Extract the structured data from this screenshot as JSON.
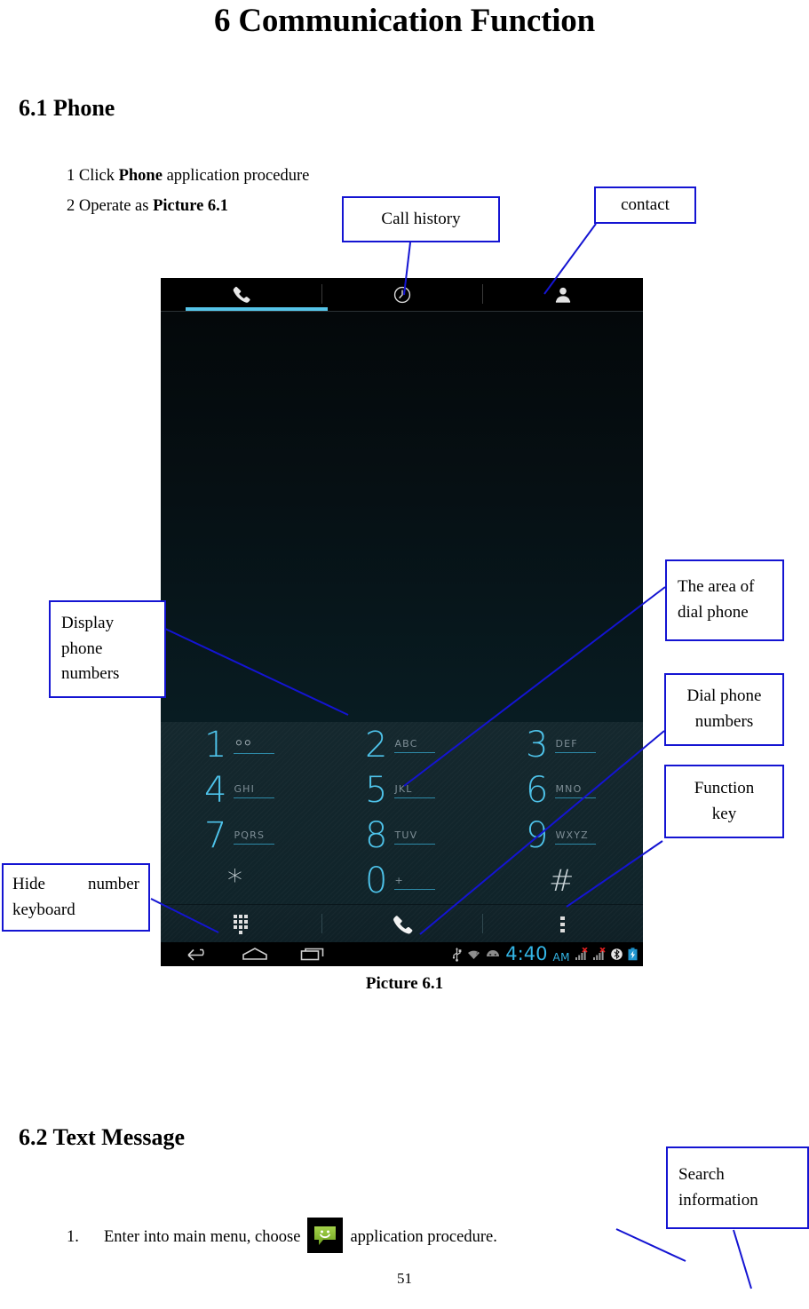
{
  "document": {
    "title": "6 Communication Function",
    "section_61": "6.1 Phone",
    "section_62": "6.2 Text Message",
    "step_1_pre": "1 Click ",
    "step_1_bold": "Phone",
    "step_1_post": " application procedure",
    "step_2_pre": "2 Operate as ",
    "step_2_bold": "Picture 6.1",
    "figure_caption": "Picture 6.1",
    "page_number": "51",
    "msg_item_number": "1.",
    "msg_item_text_a": "Enter into main menu, choose",
    "msg_item_text_b": "application procedure.",
    "sms_icon": "message-bubble-icon"
  },
  "callouts": {
    "call_history": {
      "label": "Call history"
    },
    "contact": {
      "label": "contact"
    },
    "display_phone_numbers": {
      "line1": "Display",
      "line2": "phone",
      "line3": "numbers"
    },
    "hide_number_keyboard": {
      "line1": "Hide",
      "line2": "number",
      "line3": "keyboard"
    },
    "area_of_dial_phone": {
      "line1": "The area of",
      "line2": "dial phone"
    },
    "dial_phone_numbers": {
      "line1": "Dial phone",
      "line2": "numbers"
    },
    "function_key": {
      "line1": "Function",
      "line2": "key"
    },
    "search_information": {
      "line1": "Search",
      "line2": "information"
    }
  },
  "phone": {
    "tabs": [
      {
        "name": "dialer-tab",
        "icon": "phone-handset-icon",
        "selected": true
      },
      {
        "name": "call-log-tab",
        "icon": "clock-icon",
        "selected": false
      },
      {
        "name": "contacts-tab",
        "icon": "person-icon",
        "selected": false
      }
    ],
    "accent_color": "#56c4e8",
    "digit_color": "#4ec3ea",
    "keypad": [
      {
        "digit": "1",
        "sub": "voicemail-glyph",
        "is_voicemail": true
      },
      {
        "digit": "2",
        "sub": "ABC"
      },
      {
        "digit": "3",
        "sub": "DEF"
      },
      {
        "digit": "4",
        "sub": "GHI"
      },
      {
        "digit": "5",
        "sub": "JKL"
      },
      {
        "digit": "6",
        "sub": "MNO"
      },
      {
        "digit": "7",
        "sub": "PQRS"
      },
      {
        "digit": "8",
        "sub": "TUV"
      },
      {
        "digit": "9",
        "sub": "WXYZ"
      },
      {
        "digit": "*",
        "sub": ""
      },
      {
        "digit": "0",
        "sub": "+"
      },
      {
        "digit": "#",
        "sub": ""
      }
    ],
    "actions": [
      {
        "name": "hide-dialpad-button",
        "icon": "dialpad-grid-icon"
      },
      {
        "name": "dial-call-button",
        "icon": "phone-handset-icon"
      },
      {
        "name": "overflow-menu-button",
        "icon": "three-dots-vertical-icon"
      }
    ],
    "navbar": {
      "back": "back-arrow-icon",
      "home": "home-icon",
      "recents": "recents-icon",
      "status_icons": [
        "usb-icon",
        "wifi-unknown-icon",
        "android-head-icon",
        "signal-no-sim-1-icon",
        "signal-no-sim-2-icon",
        "bluetooth-icon",
        "battery-charging-icon"
      ],
      "time": "4:40",
      "ampm": "AM"
    }
  }
}
